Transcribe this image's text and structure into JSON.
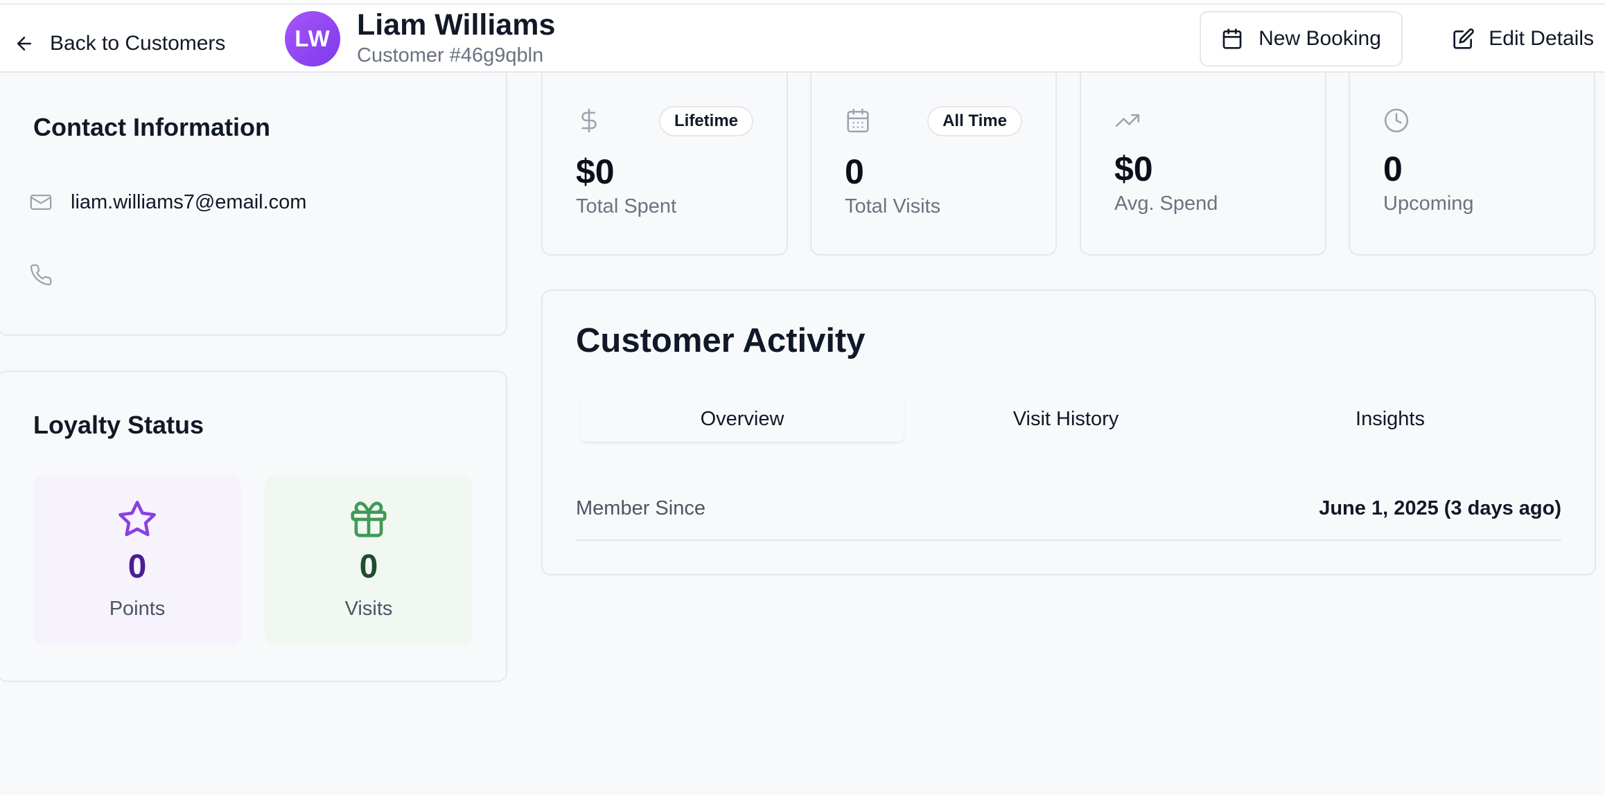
{
  "header": {
    "back_label": "Back to Customers",
    "avatar_initials": "LW",
    "customer_name": "Liam Williams",
    "customer_id": "Customer #46g9qbln",
    "new_booking_label": "New Booking",
    "edit_details_label": "Edit Details"
  },
  "contact": {
    "title": "Contact Information",
    "email": "liam.williams7@email.com",
    "phone": ""
  },
  "loyalty": {
    "title": "Loyalty Status",
    "points_value": "0",
    "points_label": "Points",
    "visits_value": "0",
    "visits_label": "Visits"
  },
  "stats": [
    {
      "icon": "dollar-icon",
      "badge": "Lifetime",
      "value": "$0",
      "label": "Total Spent"
    },
    {
      "icon": "calendar-icon",
      "badge": "All Time",
      "value": "0",
      "label": "Total Visits"
    },
    {
      "icon": "trending-up-icon",
      "badge": "",
      "value": "$0",
      "label": "Avg. Spend"
    },
    {
      "icon": "clock-icon",
      "badge": "",
      "value": "0",
      "label": "Upcoming"
    }
  ],
  "activity": {
    "title": "Customer Activity",
    "tabs": [
      {
        "label": "Overview",
        "active": true
      },
      {
        "label": "Visit History",
        "active": false
      },
      {
        "label": "Insights",
        "active": false
      }
    ],
    "member_since_label": "Member Since",
    "member_since_value": "June 1, 2025 (3 days ago)"
  },
  "colors": {
    "accent_purple": "#7c3aed",
    "points_bg": "#f7f3fd",
    "points_text": "#4c1d95",
    "visits_bg": "#f1f8f2",
    "visits_text": "#1f4d2c",
    "visits_icon": "#3f9a55"
  }
}
